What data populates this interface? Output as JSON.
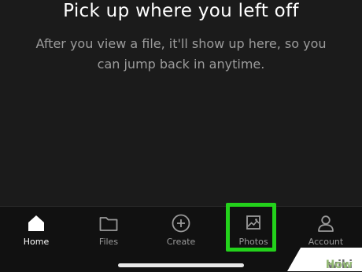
{
  "empty_state": {
    "title": "Pick up where you left off",
    "description": "After you view a file, it'll show up here, so you can jump back in anytime."
  },
  "tabbar": {
    "items": [
      {
        "label": "Home",
        "icon": "home-icon",
        "active": true
      },
      {
        "label": "Files",
        "icon": "folder-icon",
        "active": false
      },
      {
        "label": "Create",
        "icon": "plus-circle-icon",
        "active": false
      },
      {
        "label": "Photos",
        "icon": "photo-icon",
        "active": false,
        "highlighted": true
      },
      {
        "label": "Account",
        "icon": "person-icon",
        "active": false
      }
    ]
  },
  "highlight_color": "#23d21b",
  "watermark": {
    "part1": "wiki",
    "part2": "How"
  }
}
